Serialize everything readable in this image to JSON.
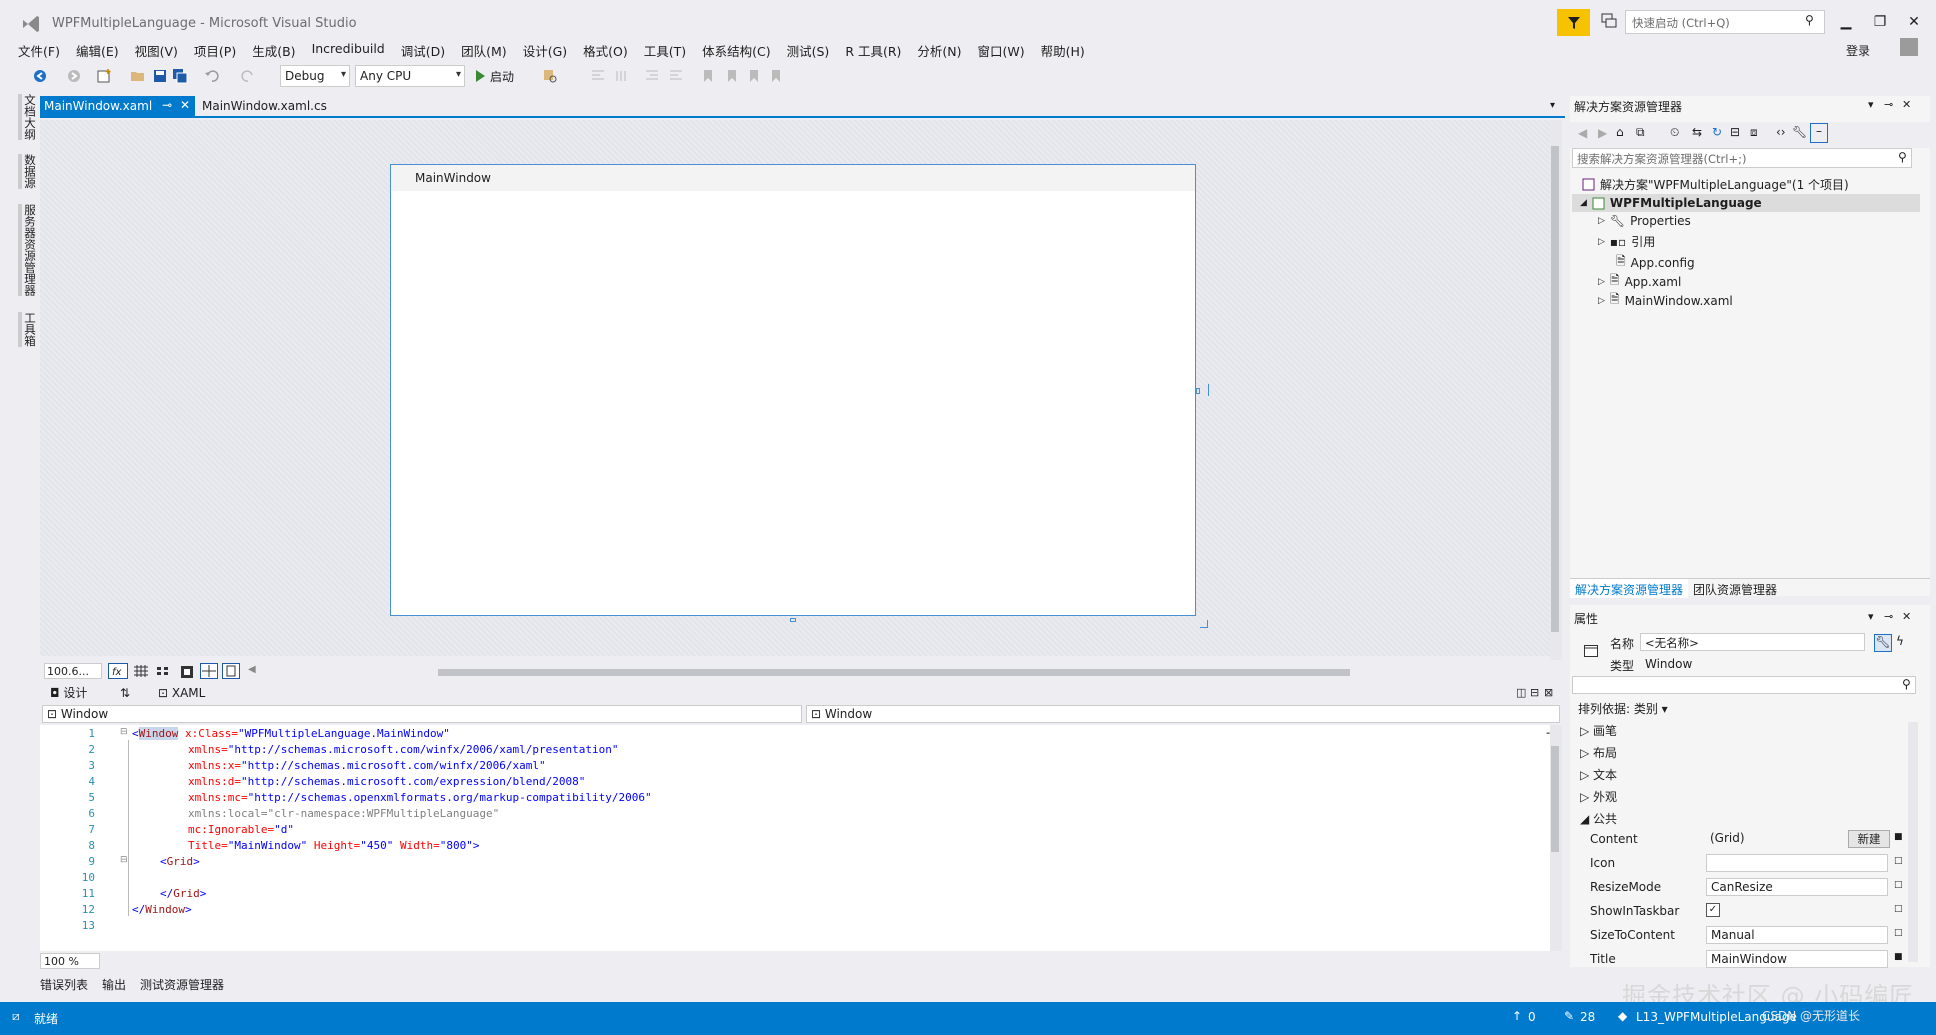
{
  "window": {
    "title": "WPFMultipleLanguage - Microsoft Visual Studio"
  },
  "quick_launch": {
    "placeholder": "快速启动 (Ctrl+Q)"
  },
  "account": {
    "login": "登录"
  },
  "menu": [
    "文件(F)",
    "编辑(E)",
    "视图(V)",
    "项目(P)",
    "生成(B)",
    "Incredibuild",
    "调试(D)",
    "团队(M)",
    "设计(G)",
    "格式(O)",
    "工具(T)",
    "体系结构(C)",
    "测试(S)",
    "R 工具(R)",
    "分析(N)",
    "窗口(W)",
    "帮助(H)"
  ],
  "toolbar": {
    "config": "Debug",
    "platform": "Any CPU",
    "start": "启动"
  },
  "left_strip": [
    "文档大纲",
    "数据源",
    "服务器资源管理器",
    "工具箱"
  ],
  "doc_tabs": {
    "active": "MainWindow.xaml",
    "other": "MainWindow.xaml.cs"
  },
  "designer": {
    "window_title": "MainWindow",
    "zoom": "100.6..."
  },
  "split": {
    "design_tab": "设计",
    "xaml_tab": "XAML",
    "swap": "⇅"
  },
  "nav": {
    "left": "Window",
    "right": "Window"
  },
  "code": {
    "line_numbers": [
      "1",
      "2",
      "3",
      "4",
      "5",
      "6",
      "7",
      "8",
      "9",
      "10",
      "11",
      "12",
      "13"
    ],
    "l1": {
      "tag": "Window",
      "attr": "x:Class=",
      "val": "\"WPFMultipleLanguage.MainWindow\""
    },
    "l2": {
      "attr": "xmlns=",
      "val": "\"http://schemas.microsoft.com/winfx/2006/xaml/presentation\""
    },
    "l3": {
      "attr": "xmlns:x=",
      "val": "\"http://schemas.microsoft.com/winfx/2006/xaml\""
    },
    "l4": {
      "attr": "xmlns:d=",
      "val": "\"http://schemas.microsoft.com/expression/blend/2008\""
    },
    "l5": {
      "attr": "xmlns:mc=",
      "val": "\"http://schemas.openxmlformats.org/markup-compatibility/2006\""
    },
    "l6": {
      "text": "xmlns:local=\"clr-namespace:WPFMultipleLanguage\""
    },
    "l7": {
      "attr": "mc:Ignorable=",
      "val": "\"d\""
    },
    "l8": {
      "a1": "Title=",
      "v1": "\"MainWindow\"",
      "a2": "Height=",
      "v2": "\"450\"",
      "a3": "Width=",
      "v3": "\"800\"",
      "end": ">"
    },
    "l9": {
      "tag": "Grid"
    },
    "l11": {
      "tag": "Grid"
    },
    "l12": {
      "tag": "Window"
    },
    "zoom": "100 %"
  },
  "bottom_tabs": [
    "错误列表",
    "输出",
    "测试资源管理器"
  ],
  "statusbar": {
    "ready": "就绪",
    "up": "0",
    "changes": "28",
    "project": "L13_WPFMultipleLanguage"
  },
  "watermark": "掘金技术社区 @ 小码编匠",
  "watermark2": "CSDN @无形道长",
  "solution_explorer": {
    "title": "解决方案资源管理器",
    "search_placeholder": "搜索解决方案资源管理器(Ctrl+;)",
    "solution": "解决方案\"WPFMultipleLanguage\"(1 个项目)",
    "project": "WPFMultipleLanguage",
    "items": [
      "Properties",
      "引用",
      "App.config",
      "App.xaml",
      "MainWindow.xaml"
    ],
    "tabs": [
      "解决方案资源管理器",
      "团队资源管理器"
    ]
  },
  "properties": {
    "title": "属性",
    "name_label": "名称",
    "name_value": "<无名称>",
    "type_label": "类型",
    "type_value": "Window",
    "sort": "排列依据: 类别 ▾",
    "categories": [
      "画笔",
      "布局",
      "文本",
      "外观",
      "公共"
    ],
    "rows": [
      {
        "key": "Content",
        "value": "(Grid)",
        "button": "新建"
      },
      {
        "key": "Icon",
        "value": ""
      },
      {
        "key": "ResizeMode",
        "value": "CanResize"
      },
      {
        "key": "ShowInTaskbar",
        "value": "✓"
      },
      {
        "key": "SizeToContent",
        "value": "Manual"
      },
      {
        "key": "Title",
        "value": "MainWindow"
      }
    ]
  }
}
